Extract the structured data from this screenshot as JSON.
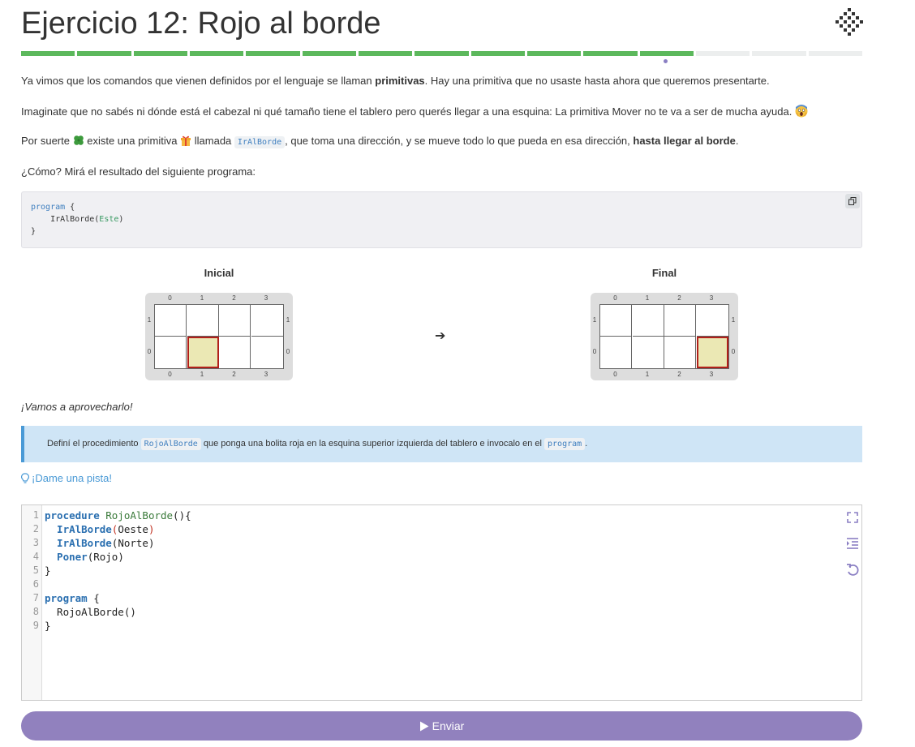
{
  "header": {
    "title": "Ejercicio 12: Rojo al borde",
    "logo_icon": "mumuki-logo-icon"
  },
  "progress": {
    "total": 15,
    "done": 12,
    "current": 12,
    "done_color": "#5cb85c",
    "pending_color": "#eceeee"
  },
  "intro": {
    "p1_a": "Ya vimos que los comandos que vienen definidos por el lenguaje se llaman ",
    "p1_b": "primitivas",
    "p1_c": ". Hay una primitiva que no usaste hasta ahora que queremos presentarte.",
    "p2": "Imaginate que no sabés ni dónde está el cabezal ni qué tamaño tiene el tablero pero querés llegar a una esquina: La primitiva Mover no te va a ser de mucha ayuda.",
    "p3_a": "Por suerte",
    "p3_b": "existe una primitiva",
    "p3_c": "llamada",
    "p3_code": "IrAlBorde",
    "p3_d": ", que toma una dirección, y se mueve todo lo que pueda en esa dirección, ",
    "p3_e": "hasta llegar al borde",
    "p3_f": ".",
    "p4": "¿Cómo? Mirá el resultado del siguiente programa:"
  },
  "example_code": {
    "line1_kw": "program",
    "line1_rest": " {",
    "line2_fn": "    IrAlBorde(",
    "line2_arg": "Este",
    "line2_end": ")",
    "line3": "}"
  },
  "boards": {
    "initial_title": "Inicial",
    "final_title": "Final",
    "columns": [
      "0",
      "1",
      "2",
      "3"
    ],
    "rows": [
      "1",
      "0"
    ],
    "initial_head": {
      "x": 1,
      "y": 0
    },
    "final_head": {
      "x": 3,
      "y": 0
    },
    "arrow": "➔"
  },
  "closing": "¡Vamos a aprovecharlo!",
  "callout": {
    "a": "Definí el procedimiento",
    "code1": "RojoAlBorde",
    "b": "que ponga una bolita roja en la esquina superior izquierda del tablero e invocalo en el",
    "code2": "program",
    "c": "."
  },
  "hint": {
    "label": "¡Dame una pista!",
    "icon": "lightbulb-icon"
  },
  "editor": {
    "line_numbers": [
      "1",
      "2",
      "3",
      "4",
      "5",
      "6",
      "7",
      "8",
      "9"
    ],
    "l1_kw": "procedure",
    "l1_name": " RojoAlBorde",
    "l1_rest": "(){",
    "l2_fn": "  IrAlBorde",
    "l2_p1": "(",
    "l2_arg": "Oeste",
    "l2_p2": ")",
    "l3_fn": "  IrAlBorde",
    "l3_rest": "(Norte)",
    "l4_fn": "  Poner",
    "l4_rest": "(Rojo)",
    "l5": "}",
    "l7_kw": "program",
    "l7_rest": " {",
    "l8": "  RojoAlBorde()",
    "l9": "}"
  },
  "submit": {
    "label": "Enviar",
    "icon": "play-icon"
  }
}
